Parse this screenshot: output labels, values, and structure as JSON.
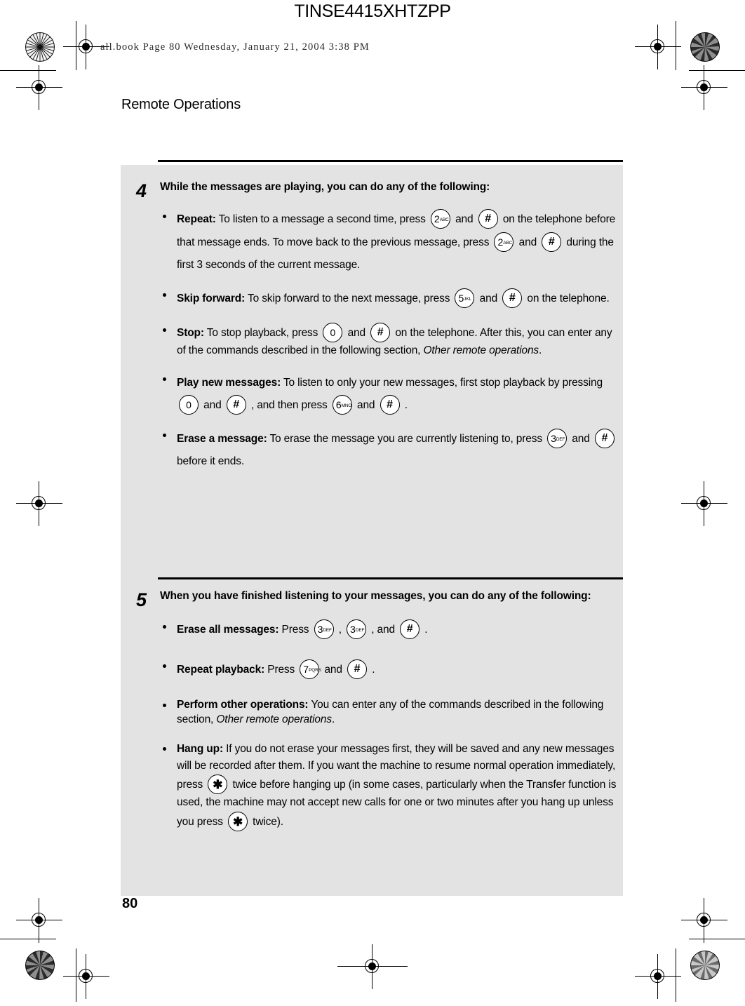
{
  "header": {
    "doc_code": "TINSE4415XHTZPP",
    "file_info": "all.book  Page 80  Wednesday, January 21, 2004  3:38 PM",
    "section_title": "Remote Operations"
  },
  "page_number": "80",
  "colors": {
    "panel_background": "#e3e3e3",
    "text": "#000000",
    "rule": "#000000",
    "page_background": "#ffffff"
  },
  "steps": [
    {
      "number": "4",
      "heading": "While the messages are playing, you can do any of the following:",
      "bullets": [
        {
          "label": "Repeat:",
          "segments": [
            " To listen to a message a second time, press ",
            {
              "key": "2",
              "letters": "ABC"
            },
            " and ",
            {
              "key": "#"
            },
            " on the telephone before that message ends. To move back to the previous message, press ",
            {
              "key": "2",
              "letters": "ABC"
            },
            " and ",
            {
              "key": "#"
            },
            " during the first 3 seconds of the current message."
          ]
        },
        {
          "label": "Skip forward:",
          "segments": [
            " To skip forward to the next message, press ",
            {
              "key": "5",
              "letters": "JKL"
            },
            " and ",
            {
              "key": "#"
            },
            " on the telephone."
          ]
        },
        {
          "label": "Stop:",
          "segments": [
            " To stop playback, press ",
            {
              "key": "0"
            },
            " and ",
            {
              "key": "#"
            },
            " on the telephone. After this, you can enter any of the commands described in the following section, ",
            {
              "italic": "Other remote operations"
            },
            "."
          ]
        },
        {
          "label": "Play new messages:",
          "segments": [
            " To listen to only your new messages, first stop playback by pressing ",
            {
              "key": "0"
            },
            " and ",
            {
              "key": "#"
            },
            " , and then press ",
            {
              "key": "6",
              "letters": "MNO"
            },
            " and ",
            {
              "key": "#"
            },
            " ."
          ]
        },
        {
          "label": "Erase a message:",
          "segments": [
            " To erase the message you are currently listening to, press ",
            {
              "key": "3",
              "letters": "DEF"
            },
            " and ",
            {
              "key": "#"
            },
            " before it ends."
          ]
        }
      ]
    },
    {
      "number": "5",
      "heading": "When you have finished listening to your messages, you can do any of the following:",
      "bullets": [
        {
          "label": "Erase all messages:",
          "segments": [
            " Press ",
            {
              "key": "3",
              "letters": "DEF"
            },
            " , ",
            {
              "key": "3",
              "letters": "DEF"
            },
            " , and ",
            {
              "key": "#"
            },
            " ."
          ]
        },
        {
          "label": "Repeat playback:",
          "segments": [
            " Press ",
            {
              "key": "7",
              "letters": "PQRS"
            },
            " and ",
            {
              "key": "#"
            },
            " ."
          ]
        },
        {
          "label": "Perform other operations:",
          "segments": [
            " You can enter any of the commands described in the following section, ",
            {
              "italic": "Other remote operations"
            },
            "."
          ]
        },
        {
          "label": "Hang up:",
          "segments": [
            " If you do not erase your messages first, they will be saved and any new messages will be recorded after them. If you want the machine to resume normal operation immediately, press ",
            {
              "key": "*"
            },
            " twice before hanging up (in some cases, particularly when the Transfer function is used, the machine may not accept new calls for one or two minutes after you hang up unless you press ",
            {
              "key": "*"
            },
            " twice)."
          ]
        }
      ]
    }
  ],
  "registration_marks": {
    "crosshair_icon": "crosshair-target-icon",
    "starburst_icon": "starburst-density-icon",
    "count": 8
  }
}
